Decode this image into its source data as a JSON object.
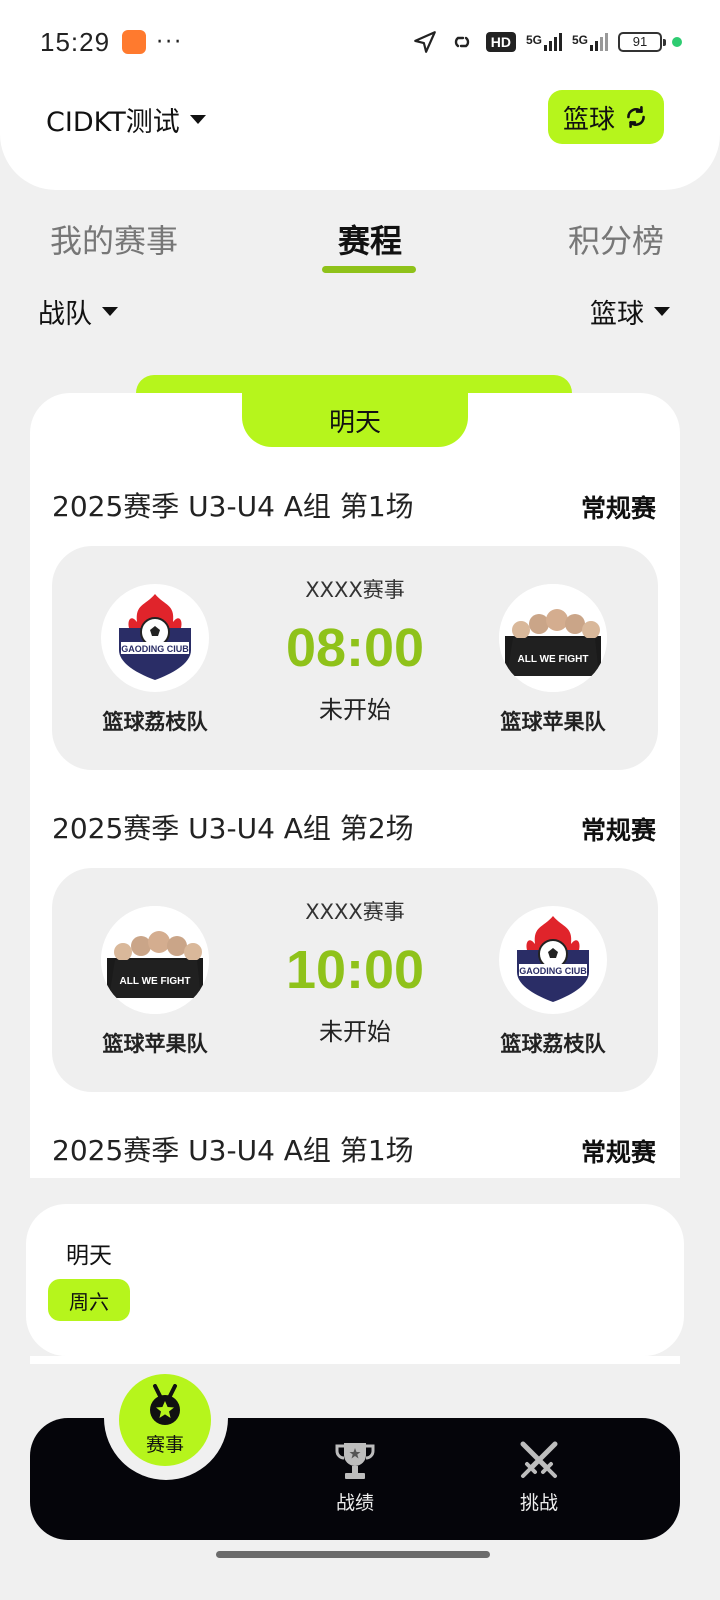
{
  "status_bar": {
    "time": "15:29",
    "dots": "···",
    "network_1": "5G",
    "network_2": "5G",
    "hd": "HD",
    "battery": "91"
  },
  "header": {
    "org_name": "CIDKT测试",
    "sport_switch_label": "篮球"
  },
  "tabs": [
    {
      "label": "我的赛事",
      "active": false
    },
    {
      "label": "赛程",
      "active": true
    },
    {
      "label": "积分榜",
      "active": false
    }
  ],
  "filters": {
    "left": "战队",
    "right": "篮球"
  },
  "schedule": {
    "day_label": "明天",
    "matches": [
      {
        "title": "2025赛季 U3-U4 A组 第1场",
        "type": "常规赛",
        "event": "XXXX赛事",
        "time": "08:00",
        "status": "未开始",
        "home": {
          "name": "篮球荔枝队",
          "logo": "gaoding-club-logo"
        },
        "away": {
          "name": "篮球苹果队",
          "logo": "team-photo"
        }
      },
      {
        "title": "2025赛季 U3-U4 A组 第2场",
        "type": "常规赛",
        "event": "XXXX赛事",
        "time": "10:00",
        "status": "未开始",
        "home": {
          "name": "篮球苹果队",
          "logo": "team-photo"
        },
        "away": {
          "name": "篮球荔枝队",
          "logo": "gaoding-club-logo"
        }
      },
      {
        "title": "2025赛季 U3-U4 A组 第1场",
        "type": "常规赛"
      }
    ]
  },
  "day_picker": {
    "label": "明天",
    "weekday": "周六"
  },
  "bottom_nav": [
    {
      "label": "赛事",
      "icon": "medal-icon",
      "active": true
    },
    {
      "label": "战绩",
      "icon": "trophy-icon",
      "active": false
    },
    {
      "label": "挑战",
      "icon": "crossed-swords-icon",
      "active": false
    }
  ],
  "colors": {
    "accent": "#b6f51c",
    "time_green": "#8fc21a",
    "nav_bg": "#05050a"
  }
}
